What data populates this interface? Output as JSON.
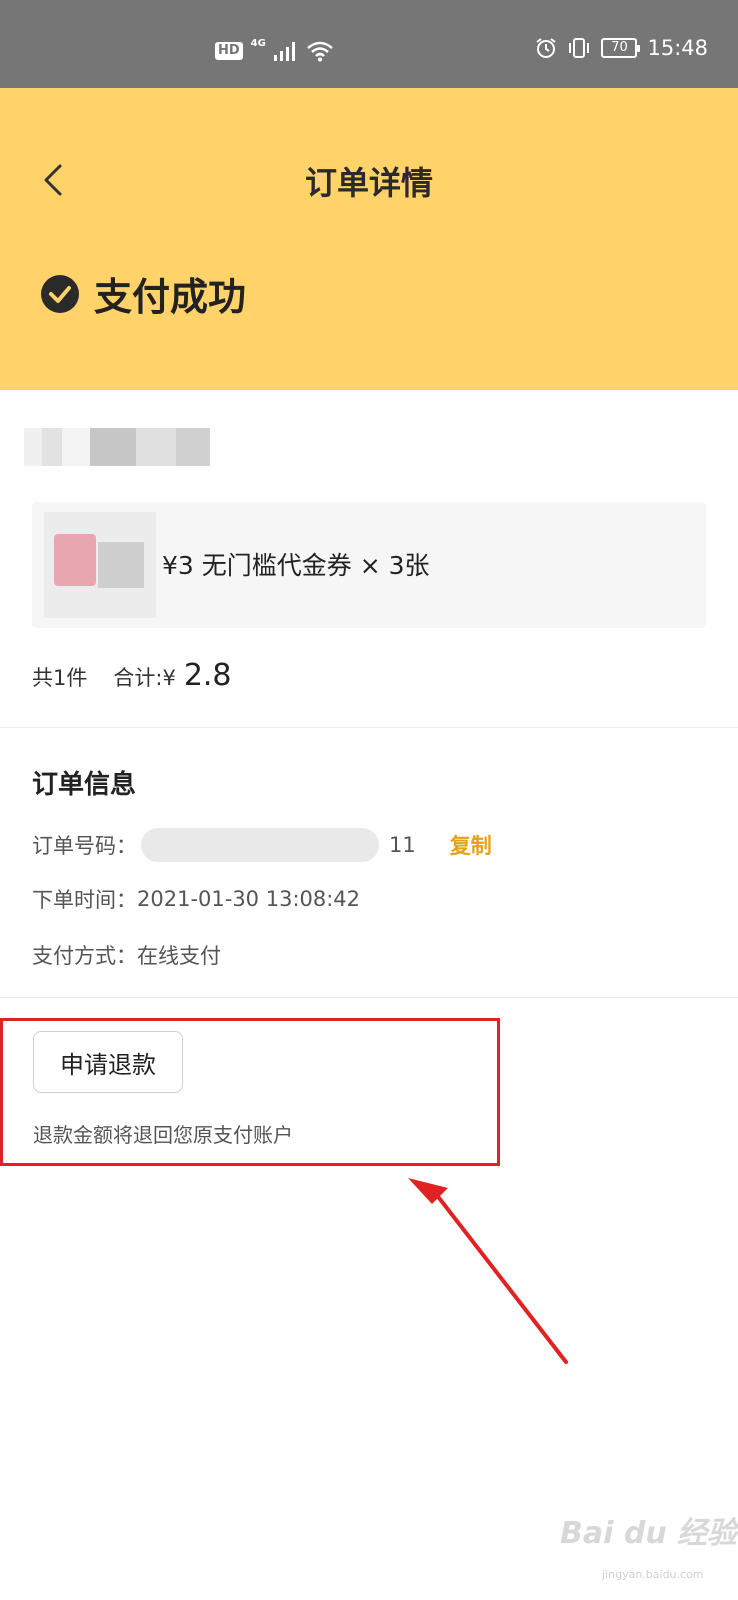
{
  "status_bar": {
    "hd_badge": "HD",
    "network": "4G",
    "battery": "70",
    "time": "15:48"
  },
  "header": {
    "title": "订单详情",
    "status": "支付成功",
    "color": "#ffd26a"
  },
  "product": {
    "item_name": "¥3 无门槛代金券 × 3张",
    "count_text": "共1件",
    "total_label": "合计:¥",
    "total_amount": "2.8"
  },
  "order_info": {
    "heading": "订单信息",
    "number_label": "订单号码：",
    "number_suffix": "11",
    "copy_label": "复制",
    "time_label": "下单时间：",
    "time_value": "2021-01-30 13:08:42",
    "pay_label": "支付方式：",
    "pay_value": "在线支付"
  },
  "refund": {
    "button_label": "申请退款",
    "note": "退款金额将退回您原支付账户"
  },
  "watermark": {
    "brand": "Bai du 经验",
    "url": "jingyan.baidu.com"
  }
}
